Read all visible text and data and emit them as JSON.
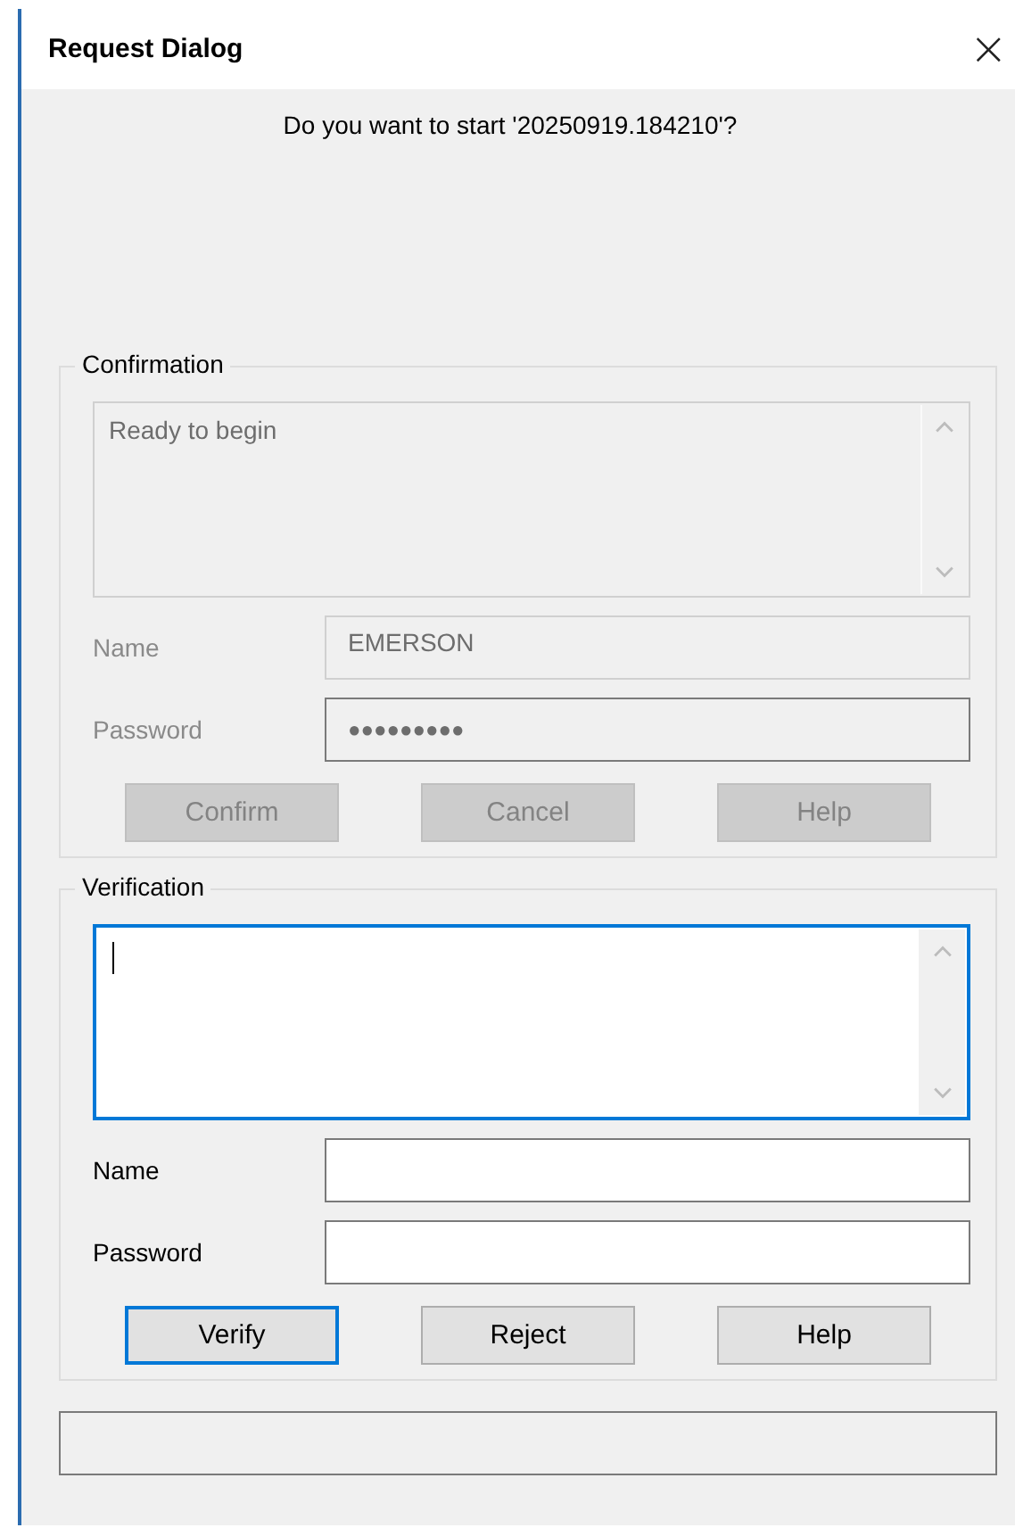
{
  "window": {
    "title": "Request Dialog",
    "close": "×"
  },
  "message": "Do you want to start '20250919.184210'?",
  "groups": [
    {
      "title": "Confirmation",
      "enabled": false,
      "notes": {
        "value": "Ready to begin",
        "focused": false
      },
      "name": {
        "label": "Name",
        "value": "EMERSON"
      },
      "password": {
        "label": "Password",
        "value": "●●●●●●●●●"
      },
      "buttons": [
        {
          "label": "Confirm",
          "default": false
        },
        {
          "label": "Cancel",
          "default": false
        },
        {
          "label": "Help",
          "default": false
        }
      ]
    },
    {
      "title": "Verification",
      "enabled": true,
      "notes": {
        "focused": true
      },
      "name": {
        "label": "Name"
      },
      "password": {
        "label": "Password"
      },
      "buttons": [
        {
          "label": "Verify",
          "default": true
        },
        {
          "label": "Reject",
          "default": false
        },
        {
          "label": "Help",
          "default": false
        }
      ]
    }
  ]
}
